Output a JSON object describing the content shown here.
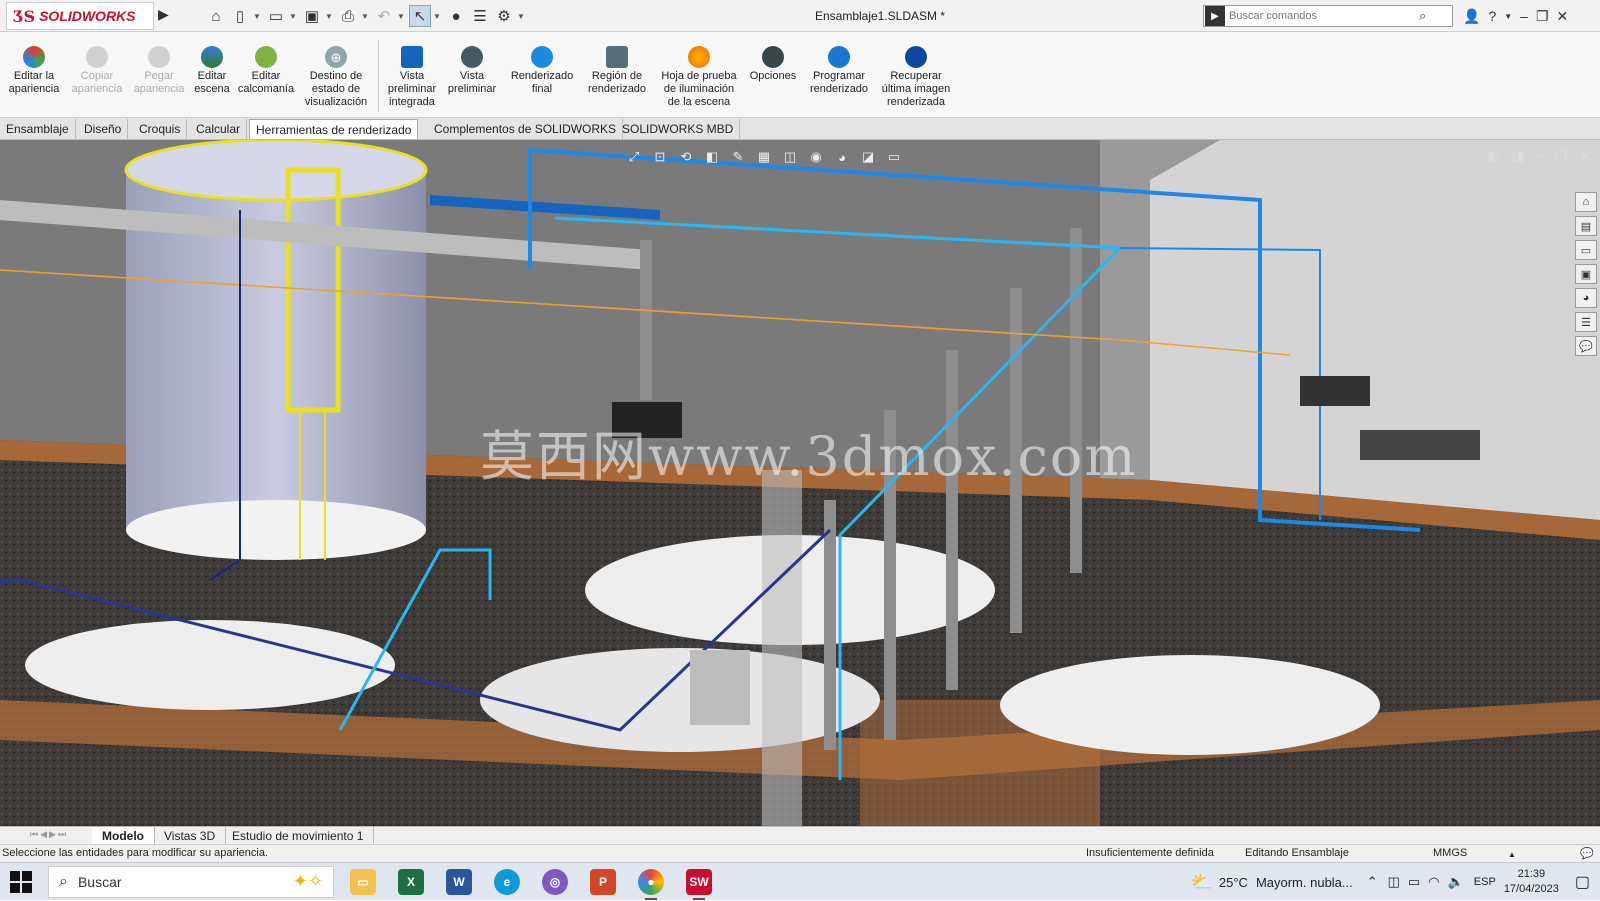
{
  "app": {
    "logo_brand": "SOLIDWORKS",
    "document_title": "Ensamblaje1.SLDASM *"
  },
  "search": {
    "placeholder": "Buscar comandos"
  },
  "ribbon": {
    "buttons": [
      {
        "label": "Editar la\napariencia",
        "icon": "edit-appearance-icon",
        "enabled": true
      },
      {
        "label": "Copiar\napariencia",
        "icon": "copy-appearance-icon",
        "enabled": false
      },
      {
        "label": "Pegar\napariencia",
        "icon": "paste-appearance-icon",
        "enabled": false
      },
      {
        "label": "Editar\nescena",
        "icon": "edit-scene-icon",
        "enabled": true
      },
      {
        "label": "Editar\ncalcomanía",
        "icon": "edit-decal-icon",
        "enabled": true
      },
      {
        "label": "Destino de\nestado de\nvisualización",
        "icon": "display-state-target-icon",
        "enabled": true
      },
      {
        "label": "Vista\npreliminar\nintegrada",
        "icon": "integrated-preview-icon",
        "enabled": true
      },
      {
        "label": "Vista\npreliminar",
        "icon": "preview-window-icon",
        "enabled": true
      },
      {
        "label": "Renderizado\nfinal",
        "icon": "final-render-icon",
        "enabled": true
      },
      {
        "label": "Región de\nrenderizado",
        "icon": "render-region-icon",
        "enabled": true
      },
      {
        "label": "Hoja de prueba\nde iluminación\nde la escena",
        "icon": "scene-illumination-proof-sheet-icon",
        "enabled": true
      },
      {
        "label": "Opciones",
        "icon": "options-icon",
        "enabled": true
      },
      {
        "label": "Programar\nrenderizado",
        "icon": "schedule-render-icon",
        "enabled": true
      },
      {
        "label": "Recuperar\núltima imagen\nrenderizada",
        "icon": "recall-last-render-icon",
        "enabled": true
      }
    ]
  },
  "tabs": [
    {
      "label": "Ensamblaje",
      "active": false
    },
    {
      "label": "Diseño",
      "active": false
    },
    {
      "label": "Croquis",
      "active": false
    },
    {
      "label": "Calcular",
      "active": false
    },
    {
      "label": "Herramientas de renderizado",
      "active": true
    },
    {
      "label": "Complementos de SOLIDWORKS",
      "active": false
    },
    {
      "label": "SOLIDWORKS MBD",
      "active": false
    }
  ],
  "viewport": {
    "watermark": "莫西网www.3dmox.com"
  },
  "bottom_tabs": [
    {
      "label": "Modelo",
      "active": true
    },
    {
      "label": "Vistas 3D",
      "active": false
    },
    {
      "label": "Estudio de movimiento 1",
      "active": false
    }
  ],
  "status": {
    "message": "Seleccione las entidades para modificar su apariencia.",
    "definition": "Insuficientemente definida",
    "mode": "Editando Ensamblaje",
    "units": "MMGS"
  },
  "taskbar": {
    "search_placeholder": "Buscar",
    "weather_temp": "25°C",
    "weather_desc": "Mayorm. nubla...",
    "language": "ESP",
    "time": "21:39",
    "date": "17/04/2023"
  },
  "colors": {
    "accent": "#c8102e",
    "pipe_blue": "#1e88e5",
    "ladder_yellow": "#e8e020",
    "slab_orange": "#c87a3a"
  }
}
